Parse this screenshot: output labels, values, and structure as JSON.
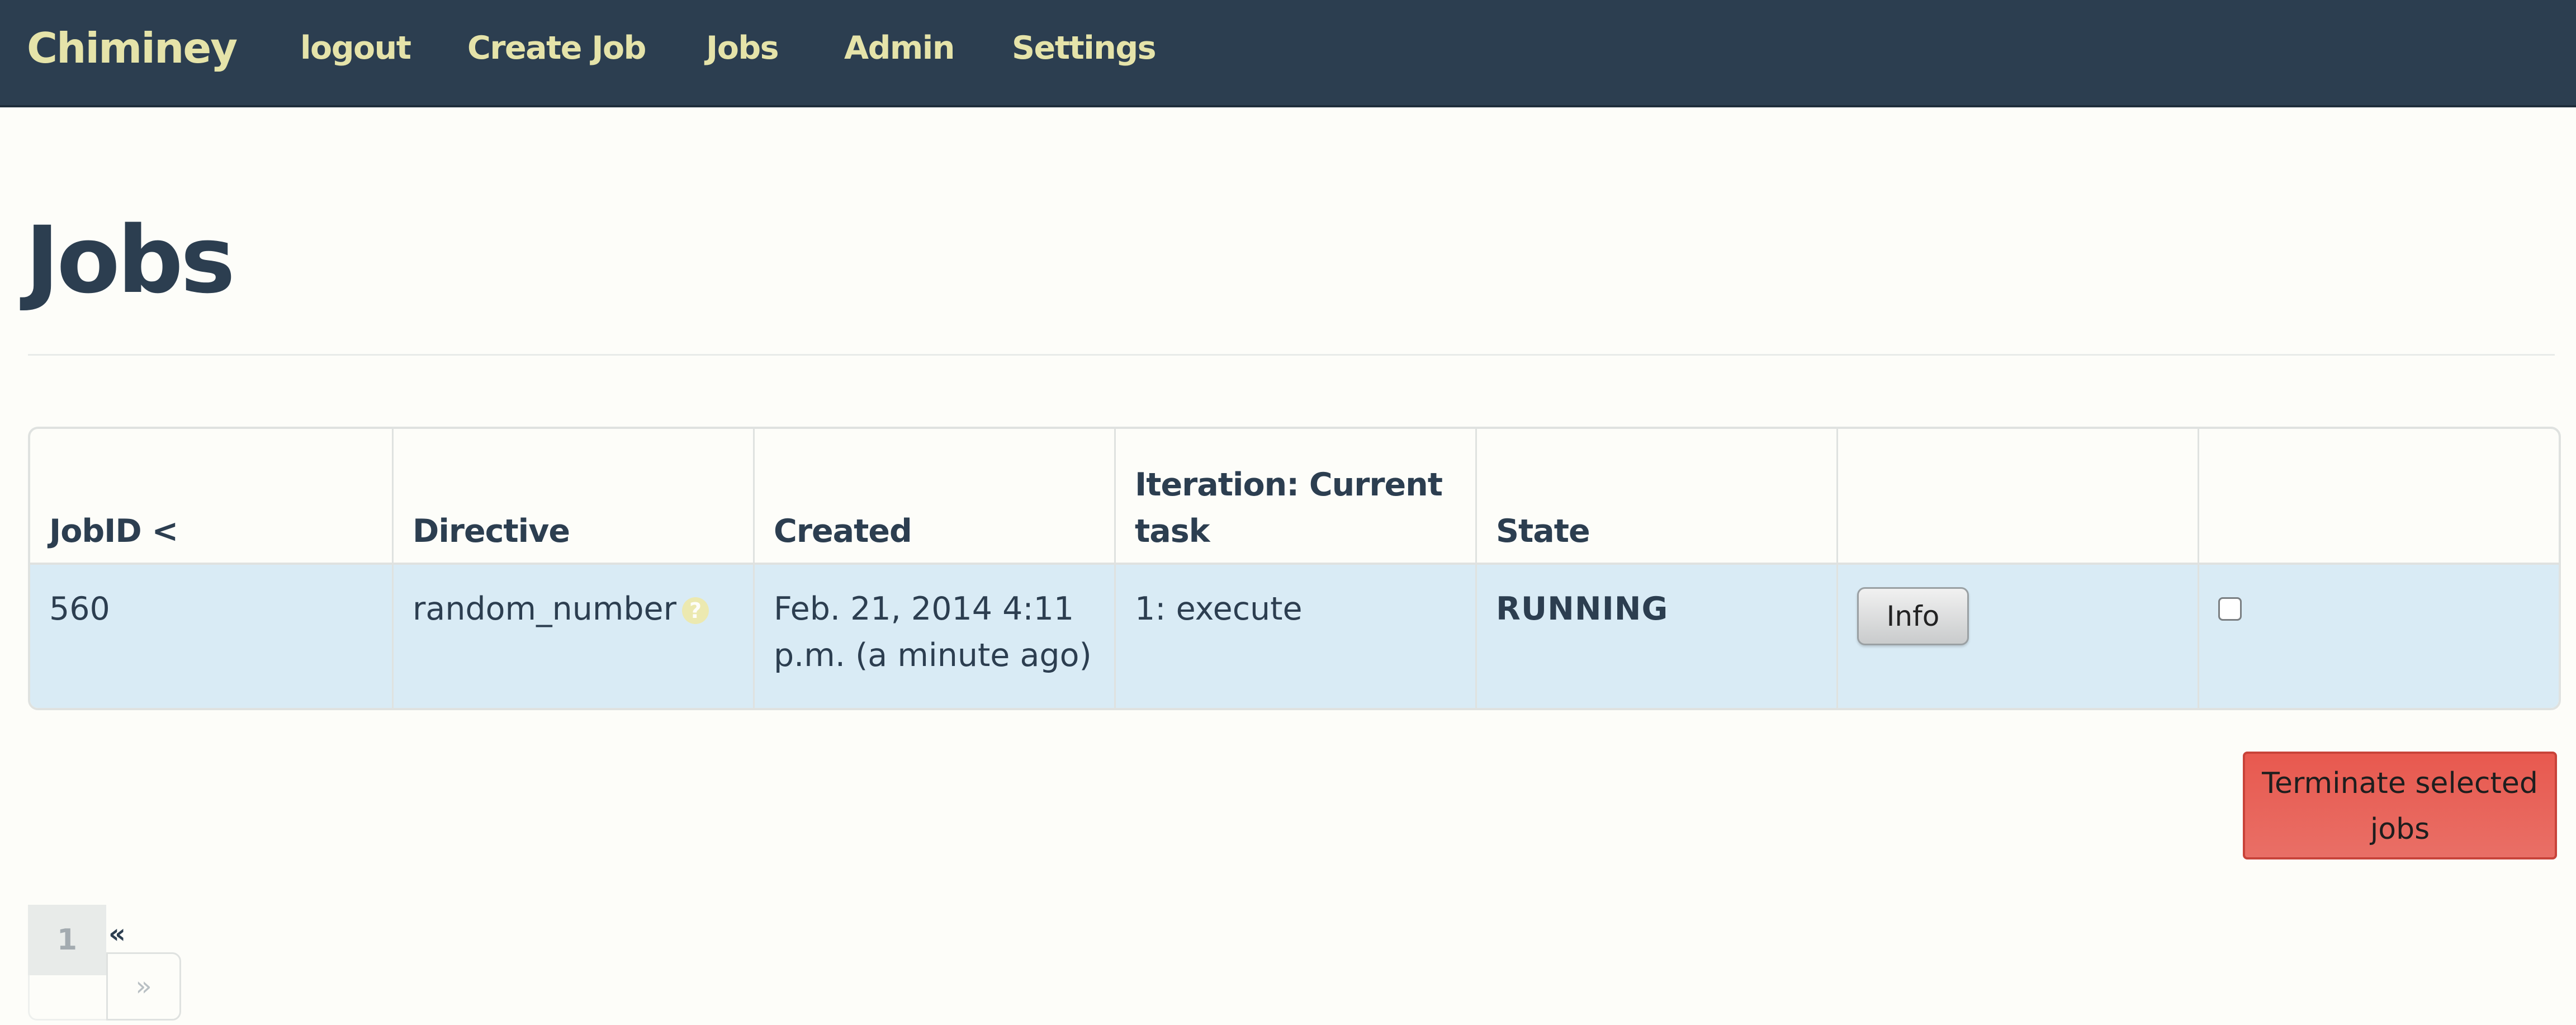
{
  "nav": {
    "brand": "Chiminey",
    "links": [
      "logout",
      "Create Job",
      "Jobs",
      "Admin",
      "Settings"
    ]
  },
  "page": {
    "title": "Jobs"
  },
  "table": {
    "headers": [
      "JobID <",
      "Directive",
      "Created",
      "Iteration: Current task",
      "State",
      "",
      ""
    ],
    "rows": [
      {
        "job_id": "560",
        "directive": "random_number",
        "help_icon_name": "question-circle-icon",
        "help_glyph": "?",
        "created": "Feb. 21, 2014 4:11 p.m. (a minute ago)",
        "iteration": "1: execute",
        "state": "RUNNING",
        "info_label": "Info",
        "selected": false
      }
    ]
  },
  "actions": {
    "terminate_label": "Terminate selected jobs"
  },
  "pagination": {
    "current_page": "1",
    "prev_label": "«",
    "next_label": "»"
  },
  "colors": {
    "navbar_bg": "#2c3e50",
    "nav_text": "#e5e3a9",
    "row_highlight": "#d9ebf5",
    "danger": "#e8594f"
  }
}
